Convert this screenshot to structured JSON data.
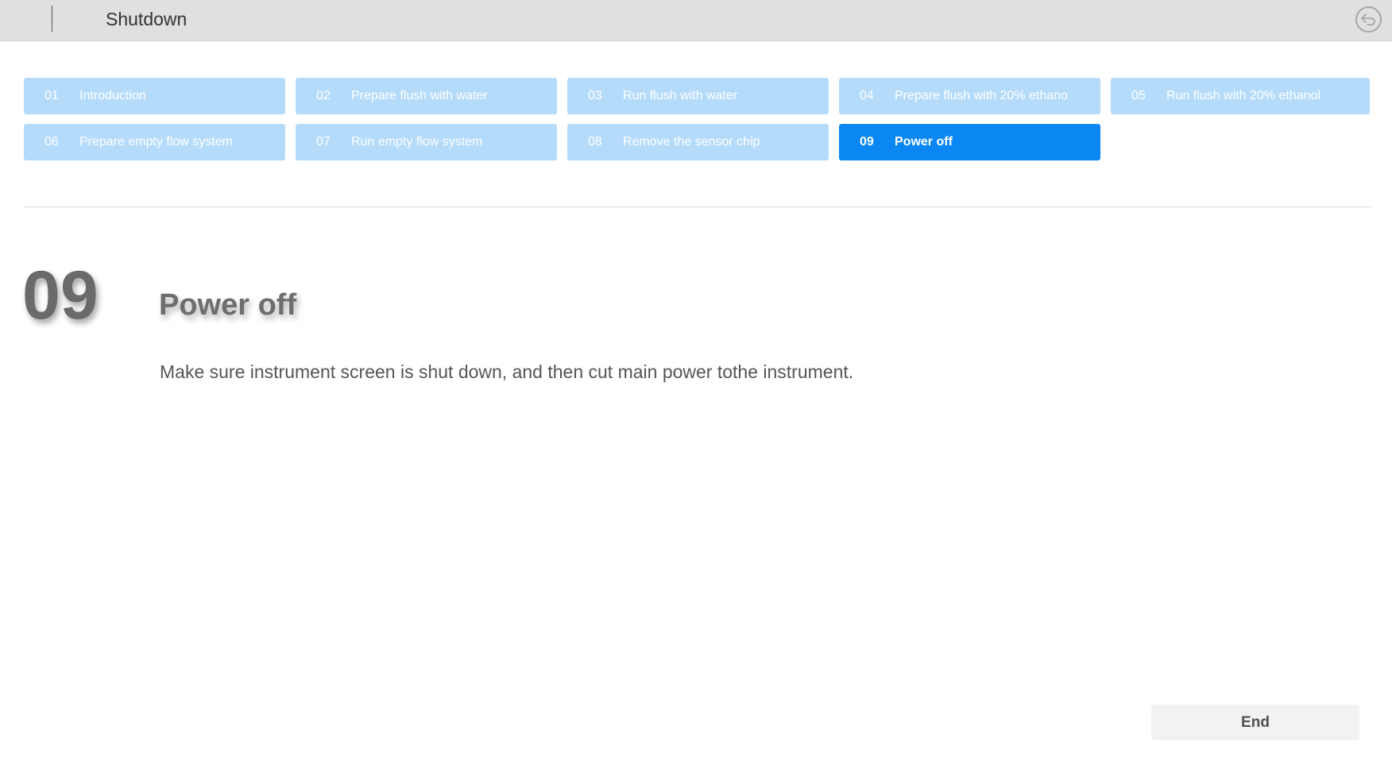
{
  "header": {
    "title": "Shutdown",
    "back_icon": "back-arrow-icon"
  },
  "steps": [
    {
      "num": "01",
      "label": "Introduction",
      "active": false
    },
    {
      "num": "02",
      "label": "Prepare flush with water",
      "active": false
    },
    {
      "num": "03",
      "label": "Run flush with water",
      "active": false
    },
    {
      "num": "04",
      "label": "Prepare flush with 20% ethano",
      "active": false
    },
    {
      "num": "05",
      "label": "Run flush with 20% ethanol",
      "active": false
    },
    {
      "num": "06",
      "label": "Prepare empty flow system",
      "active": false
    },
    {
      "num": "07",
      "label": "Run empty flow system",
      "active": false
    },
    {
      "num": "08",
      "label": "Remove the sensor chip",
      "active": false
    },
    {
      "num": "09",
      "label": "Power off",
      "active": true
    }
  ],
  "current": {
    "num": "09",
    "title": "Power off",
    "description": "Make sure instrument screen is shut down, and then cut main power tothe instrument."
  },
  "footer": {
    "end_label": "End"
  },
  "colors": {
    "step_inactive": "#b5dbfb",
    "step_active": "#0a87f2",
    "header_bg": "#e0e0e0"
  }
}
